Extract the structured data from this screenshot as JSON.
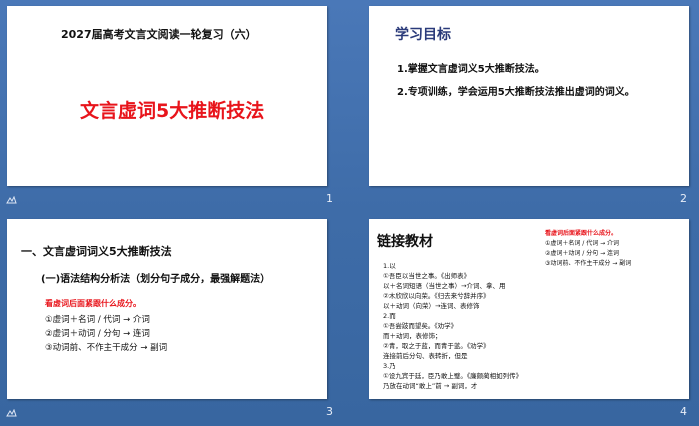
{
  "slides": [
    {
      "number": "1",
      "subtitle": "2027届高考文言文阅读一轮复习（六）",
      "title": "文言虚词5大推断技法"
    },
    {
      "number": "2",
      "heading": "学习目标",
      "items": [
        "1.掌握文言虚词义5大推断技法。",
        "2.专项训练，学会运用5大推断技法推出虚词的词义。"
      ]
    },
    {
      "number": "3",
      "heading": "一、文言虚词词义5大推断技法",
      "subheading": "(一)语法结构分析法（划分句子成分，最强解题法）",
      "note": "看虚词后面紧跟什么成分。",
      "rules": [
        "①虚词＋名词 / 代词 → 介词",
        "②虚词＋动词 / 分句 → 连词",
        "③动词前、不作主干成分 → 副词"
      ]
    },
    {
      "number": "4",
      "heading": "链接教材",
      "note": "看虚词后面紧跟什么成分。",
      "rules": [
        "①虚词＋名词 / 代词 → 介词",
        "②虚词＋动词 / 分句 → 连词",
        "③动词前、不作主干成分 → 副词"
      ],
      "lines": [
        "1.以",
        "①吾臣以当世之事。《出师表》",
        "以＋名词短语（当世之事）→介词、拿、用",
        "②木欣欣以向荣。《归去来兮辞并序》",
        "以＋动词（向荣）→连词、表修饰",
        "2.而",
        "①吾尝跂而望矣。《劝学》",
        "而＋动词，表修饰；",
        "②青，取之于蓝，而青于蓝。《劝学》",
        "连接前后分句、表转折，但是",
        "3.乃",
        "①设九宾于廷，臣乃敢上璧。《廉颇蔺相如列传》",
        "乃放在动词“敢上”前 → 副词，才"
      ]
    }
  ],
  "colors": {
    "background": "#4270ae",
    "slide": "#ffffff",
    "title_red": "#e8141b",
    "note_red": "#e8141b",
    "heading_blue": "#2a3a7a"
  },
  "icons": [
    "star-icon"
  ]
}
